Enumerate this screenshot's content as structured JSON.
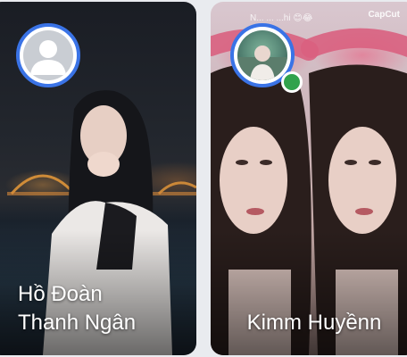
{
  "cards": [
    {
      "name_line1": "Hồ Đoàn",
      "name_line2": "Thanh Ngân",
      "avatar": "default-avatar",
      "online": false
    },
    {
      "name": "Kimm Huyềnn",
      "avatar": "photo-avatar",
      "online": true,
      "caption": "N... ... ...hi 😊😂",
      "watermark": "CapCut"
    }
  ],
  "colors": {
    "ring": "#3a73e6",
    "online": "#31a24c",
    "page_bg": "#e9ebef"
  }
}
